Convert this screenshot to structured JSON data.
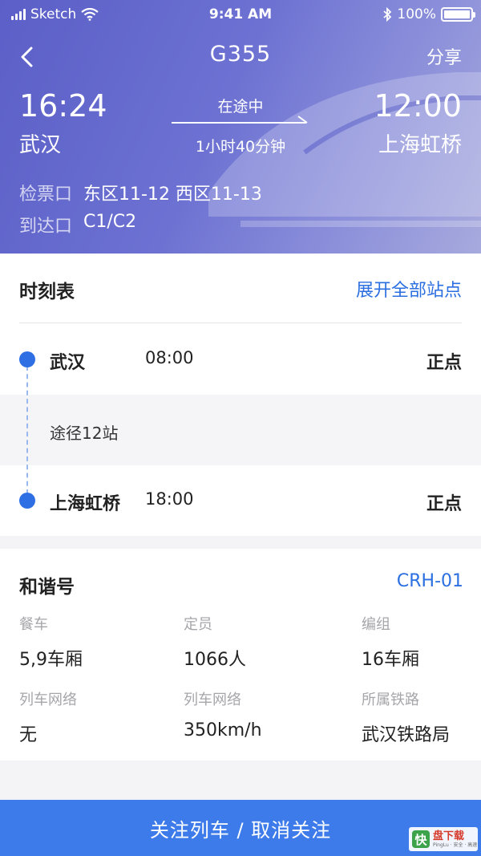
{
  "status_bar": {
    "carrier": "Sketch",
    "time": "9:41 AM",
    "battery": "100%",
    "battery_level": 1.0,
    "signal_icon": "signal-bars-icon",
    "wifi_icon": "wifi-icon",
    "bluetooth_icon": "bluetooth-icon"
  },
  "nav": {
    "back_icon": "chevron-left-icon",
    "title": "G355",
    "share_label": "分享"
  },
  "trip": {
    "departure_time": "16:24",
    "departure_station": "武汉",
    "arrival_time": "12:00",
    "arrival_station": "上海虹桥",
    "status": "在途中",
    "duration": "1小时40分钟"
  },
  "gate": {
    "label": "检票口",
    "value": "东区11-12 西区11-13"
  },
  "exit": {
    "label": "到达口",
    "value": "C1/C2"
  },
  "schedule": {
    "title": "时刻表",
    "expand_label": "展开全部站点",
    "stops": [
      {
        "name": "武汉",
        "time": "08:00",
        "status": "正点"
      },
      {
        "name": "上海虹桥",
        "time": "18:00",
        "status": "正点"
      }
    ],
    "via_text": "途径12站"
  },
  "train": {
    "type": "和谐号",
    "model": "CRH-01",
    "specs": [
      {
        "key": "餐车",
        "value": "5,9车厢"
      },
      {
        "key": "定员",
        "value": "1066人"
      },
      {
        "key": "编组",
        "value": "16车厢"
      },
      {
        "key": "列车网络",
        "value": "无"
      },
      {
        "key": "列车网络",
        "value": "350km/h"
      },
      {
        "key": "所属铁路",
        "value": "武汉铁路局"
      }
    ]
  },
  "follow_button": "关注列车 / 取消关注",
  "watermark": {
    "mark": "快",
    "title": "盘下载",
    "subtitle": "PingLu · 安全 · 高速"
  },
  "colors": {
    "header_gradient_start": "#5b5fc7",
    "accent_blue": "#2b6fe0",
    "button_blue": "#3e7bea",
    "dot_blue": "#2f6fe4"
  }
}
